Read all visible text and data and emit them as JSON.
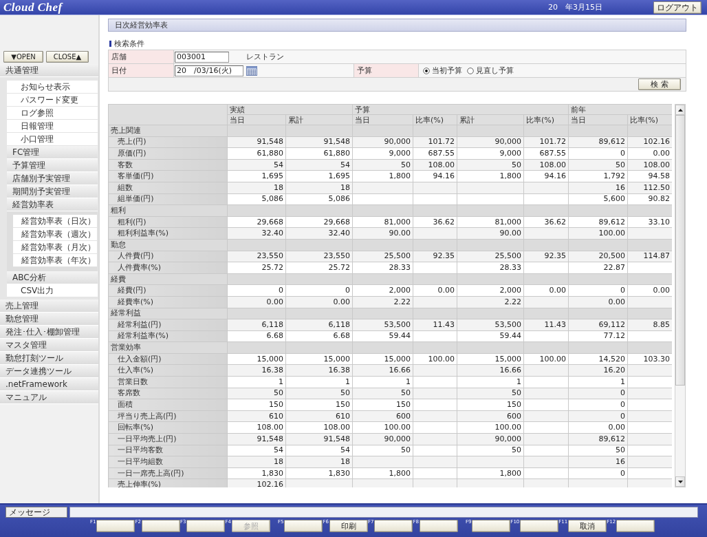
{
  "header": {
    "logo": "Cloud Chef",
    "date": "20　年3月15日",
    "logout_button": "ログアウト"
  },
  "sidebar": {
    "open_button": "▼OPEN",
    "close_button": "CLOSE▲",
    "items": [
      {
        "label": "共通管理",
        "children": [
          {
            "label": "お知らせ表示",
            "kind": "page"
          },
          {
            "label": "パスワード変更",
            "kind": "page"
          },
          {
            "label": "ログ参照",
            "kind": "page"
          },
          {
            "label": "日報管理",
            "kind": "page"
          },
          {
            "label": "小口管理",
            "kind": "page"
          },
          {
            "label": "FC管理",
            "kind": "group"
          },
          {
            "label": "予算管理",
            "kind": "group"
          },
          {
            "label": "店舗別予実管理",
            "kind": "group"
          },
          {
            "label": "期間別予実管理",
            "kind": "group"
          },
          {
            "label": "経営効率表",
            "kind": "group",
            "children": [
              {
                "label": "経営効率表（日次）"
              },
              {
                "label": "経営効率表（週次）"
              },
              {
                "label": "経営効率表（月次）"
              },
              {
                "label": "経営効率表（年次）"
              }
            ]
          },
          {
            "label": "ABC分析",
            "kind": "group"
          },
          {
            "label": "CSV出力",
            "kind": "page"
          }
        ]
      },
      {
        "label": "売上管理"
      },
      {
        "label": "勤怠管理"
      },
      {
        "label": "発注･仕入･棚卸管理"
      },
      {
        "label": "マスタ管理"
      },
      {
        "label": "勤怠打刻ツール"
      },
      {
        "label": "データ連携ツール"
      },
      {
        "label": ".netFramework"
      },
      {
        "label": "マニュアル"
      }
    ]
  },
  "page_title": "日次経営効率表",
  "search": {
    "title": "検索条件",
    "store": {
      "label": "店舗",
      "value": "003001",
      "name": "レストラン"
    },
    "date": {
      "label": "日付",
      "value": "20　/03/16(火)"
    },
    "budget": {
      "label": "予算",
      "options": [
        {
          "label": "当初予算",
          "selected": true
        },
        {
          "label": "見直し予算",
          "selected": false
        }
      ]
    },
    "search_button": "検 索"
  },
  "table": {
    "column_groups": [
      {
        "label": "実績",
        "columns": [
          "当日",
          "累計"
        ]
      },
      {
        "label": "予算",
        "columns": [
          "当日",
          "比率(%)",
          "累計",
          "比率(%)"
        ]
      },
      {
        "label": "前年",
        "columns": [
          "当日",
          "比率(%)"
        ]
      }
    ],
    "sections": [
      {
        "label": "売上関連",
        "rows": [
          {
            "label": "売上(円)",
            "cells": [
              "91,548",
              "91,548",
              "90,000",
              "101.72",
              "90,000",
              "101.72",
              "89,612",
              "102.16"
            ]
          },
          {
            "label": "原価(円)",
            "cells": [
              "61,880",
              "61,880",
              "9,000",
              "687.55",
              "9,000",
              "687.55",
              "0",
              "0.00"
            ]
          },
          {
            "label": "客数",
            "cells": [
              "54",
              "54",
              "50",
              "108.00",
              "50",
              "108.00",
              "50",
              "108.00"
            ]
          },
          {
            "label": "客単価(円)",
            "cells": [
              "1,695",
              "1,695",
              "1,800",
              "94.16",
              "1,800",
              "94.16",
              "1,792",
              "94.58"
            ]
          },
          {
            "label": "組数",
            "cells": [
              "18",
              "18",
              null,
              null,
              null,
              null,
              "16",
              "112.50"
            ]
          },
          {
            "label": "組単価(円)",
            "cells": [
              "5,086",
              "5,086",
              null,
              null,
              null,
              null,
              "5,600",
              "90.82"
            ]
          }
        ]
      },
      {
        "label": "粗利",
        "rows": [
          {
            "label": "粗利(円)",
            "cells": [
              "29,668",
              "29,668",
              "81,000",
              "36.62",
              "81,000",
              "36.62",
              "89,612",
              "33.10"
            ]
          },
          {
            "label": "粗利利益率(%)",
            "cells": [
              "32.40",
              "32.40",
              "90.00",
              null,
              "90.00",
              null,
              "100.00",
              null
            ]
          }
        ]
      },
      {
        "label": "勤怠",
        "rows": [
          {
            "label": "人件費(円)",
            "cells": [
              "23,550",
              "23,550",
              "25,500",
              "92.35",
              "25,500",
              "92.35",
              "20,500",
              "114.87"
            ]
          },
          {
            "label": "人件費率(%)",
            "cells": [
              "25.72",
              "25.72",
              "28.33",
              null,
              "28.33",
              null,
              "22.87",
              null
            ]
          }
        ]
      },
      {
        "label": "経費",
        "rows": [
          {
            "label": "経費(円)",
            "cells": [
              "0",
              "0",
              "2,000",
              "0.00",
              "2,000",
              "0.00",
              "0",
              "0.00"
            ]
          },
          {
            "label": "経費率(%)",
            "cells": [
              "0.00",
              "0.00",
              "2.22",
              null,
              "2.22",
              null,
              "0.00",
              null
            ]
          }
        ]
      },
      {
        "label": "経常利益",
        "rows": [
          {
            "label": "経常利益(円)",
            "cells": [
              "6,118",
              "6,118",
              "53,500",
              "11.43",
              "53,500",
              "11.43",
              "69,112",
              "8.85"
            ]
          },
          {
            "label": "経常利益率(%)",
            "cells": [
              "6.68",
              "6.68",
              "59.44",
              null,
              "59.44",
              null,
              "77.12",
              null
            ]
          }
        ]
      },
      {
        "label": "営業効率",
        "rows": [
          {
            "label": "仕入金額(円)",
            "cells": [
              "15,000",
              "15,000",
              "15,000",
              "100.00",
              "15,000",
              "100.00",
              "14,520",
              "103.30"
            ]
          },
          {
            "label": "仕入率(%)",
            "cells": [
              "16.38",
              "16.38",
              "16.66",
              null,
              "16.66",
              null,
              "16.20",
              null
            ]
          },
          {
            "label": "営業日数",
            "cells": [
              "1",
              "1",
              "1",
              null,
              "1",
              null,
              "1",
              null
            ]
          },
          {
            "label": "客席数",
            "cells": [
              "50",
              "50",
              "50",
              null,
              "50",
              null,
              "0",
              null
            ]
          },
          {
            "label": "面積",
            "cells": [
              "150",
              "150",
              "150",
              null,
              "150",
              null,
              "0",
              null
            ]
          },
          {
            "label": "坪当り売上高(円)",
            "cells": [
              "610",
              "610",
              "600",
              null,
              "600",
              null,
              "0",
              null
            ]
          },
          {
            "label": "回転率(%)",
            "cells": [
              "108.00",
              "108.00",
              "100.00",
              null,
              "100.00",
              null,
              "0.00",
              null
            ]
          },
          {
            "label": "一日平均売上(円)",
            "cells": [
              "91,548",
              "91,548",
              "90,000",
              null,
              "90,000",
              null,
              "89,612",
              null
            ]
          },
          {
            "label": "一日平均客数",
            "cells": [
              "54",
              "54",
              "50",
              null,
              "50",
              null,
              "50",
              null
            ]
          },
          {
            "label": "一日平均組数",
            "cells": [
              "18",
              "18",
              null,
              null,
              null,
              null,
              "16",
              null
            ]
          },
          {
            "label": "一日一席売上高(円)",
            "cells": [
              "1,830",
              "1,830",
              "1,800",
              null,
              "1,800",
              null,
              "0",
              null
            ]
          },
          {
            "label": "売上伸率(%)",
            "cells": [
              "102.16",
              null,
              null,
              null,
              null,
              null,
              null,
              null
            ]
          }
        ]
      }
    ]
  },
  "footer": {
    "message_label": "メッセージ",
    "function_keys": [
      {
        "key": "F1",
        "disabled": false
      },
      {
        "key": "F2",
        "disabled": false
      },
      {
        "key": "F3",
        "disabled": false
      },
      {
        "key": "F4",
        "label": "参照",
        "disabled": true
      },
      {
        "key": "F5",
        "disabled": false
      },
      {
        "key": "F6",
        "label": "印刷",
        "disabled": false
      },
      {
        "key": "F7",
        "disabled": false
      },
      {
        "key": "F8",
        "disabled": false
      },
      {
        "key": "F9",
        "disabled": false
      },
      {
        "key": "F10",
        "disabled": false
      },
      {
        "key": "F11",
        "label": "取消",
        "disabled": false
      },
      {
        "key": "F12",
        "disabled": false
      }
    ]
  }
}
